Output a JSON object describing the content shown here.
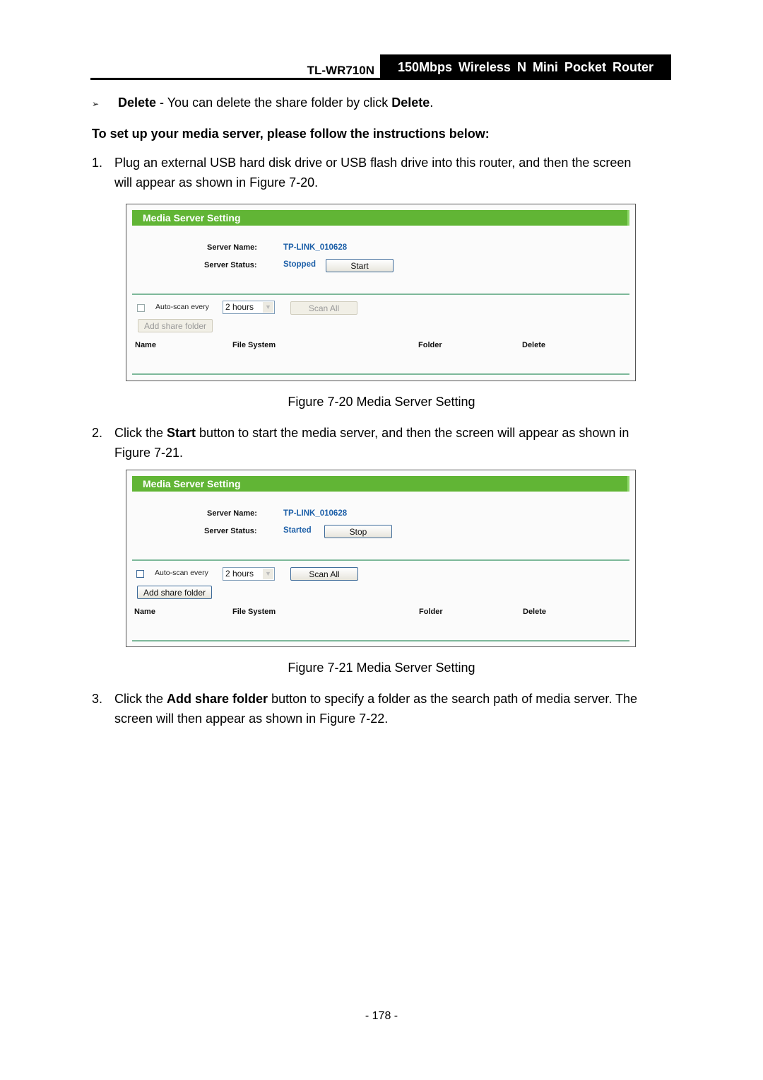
{
  "header": {
    "model": "TL-WR710N",
    "product": "150Mbps Wireless N Mini Pocket Router"
  },
  "bullet": {
    "icon": "arrow-bullet-icon",
    "glyph": "➢",
    "term": "Delete",
    "text": " - You can delete the share folder by click ",
    "term2": "Delete",
    "end": "."
  },
  "heading": "To set up your media server, please follow the instructions below:",
  "steps": [
    {
      "num": "1.",
      "line1": "Plug an external USB hard disk drive or USB flash drive into this router, and then the screen",
      "line2": "will appear as shown in Figure 7-20."
    },
    {
      "num": "2.",
      "pre": "Click the ",
      "bold": "Start",
      "post": " button to start the media server, and then the screen will appear as shown in",
      "line2": "Figure 7-21."
    },
    {
      "num": "3.",
      "pre": "Click the ",
      "bold": "Add share folder",
      "post": " button to specify a folder as the search path of media server. The",
      "line2": "screen will then appear as shown in Figure 7-22."
    }
  ],
  "figures": [
    {
      "caption": "Figure 7-20 Media Server Setting",
      "title": "Media Server Setting",
      "server_name_label": "Server Name:",
      "server_name": "TP-LINK_010628",
      "server_status_label": "Server Status:",
      "server_status": "Stopped",
      "action_button": "Start",
      "auto_scan_checked": false,
      "auto_scan_label": "Auto-scan every",
      "interval": "2 hours",
      "scan_all": "Scan All",
      "add_share_folder": "Add share folder",
      "controls_enabled": false,
      "columns": [
        "Name",
        "File System",
        "Folder",
        "Delete"
      ]
    },
    {
      "caption": "Figure 7-21 Media Server Setting",
      "title": "Media Server Setting",
      "server_name_label": "Server Name:",
      "server_name": "TP-LINK_010628",
      "server_status_label": "Server Status:",
      "server_status": "Started",
      "action_button": "Stop",
      "auto_scan_checked": false,
      "auto_scan_label": "Auto-scan every",
      "interval": "2 hours",
      "scan_all": "Scan All",
      "add_share_folder": "Add share folder",
      "controls_enabled": true,
      "columns": [
        "Name",
        "File System",
        "Folder",
        "Delete"
      ]
    }
  ],
  "page_number": "- 178 -"
}
